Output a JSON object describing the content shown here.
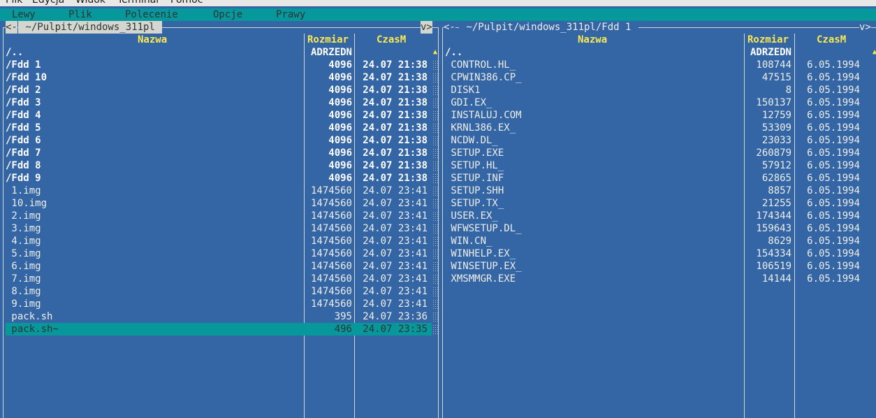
{
  "terminal_menu": [
    "Plik",
    "Edycja",
    "Widok",
    "Terminal",
    "Pomoc"
  ],
  "mc_menu": [
    "Lewy",
    "Plik",
    "Polecenie",
    "Opcje",
    "Prawy"
  ],
  "left_panel": {
    "corner_left": "<-",
    "path": " ~/Pulpit/windows_311pl ",
    "corner_right": "v>",
    "headers": {
      "name": "Nazwa",
      "size": "Rozmiar",
      "mtime": "CzasM"
    },
    "rows": [
      {
        "name": "/..",
        "size": "ADRZEDN",
        "time": "",
        "style": "updir"
      },
      {
        "name": "/Fdd 1",
        "size": "4096",
        "time": "24.07 21:38",
        "style": "dir"
      },
      {
        "name": "/Fdd 10",
        "size": "4096",
        "time": "24.07 21:38",
        "style": "dir"
      },
      {
        "name": "/Fdd 2",
        "size": "4096",
        "time": "24.07 21:38",
        "style": "dir"
      },
      {
        "name": "/Fdd 3",
        "size": "4096",
        "time": "24.07 21:38",
        "style": "dir"
      },
      {
        "name": "/Fdd 4",
        "size": "4096",
        "time": "24.07 21:38",
        "style": "dir"
      },
      {
        "name": "/Fdd 5",
        "size": "4096",
        "time": "24.07 21:38",
        "style": "dir"
      },
      {
        "name": "/Fdd 6",
        "size": "4096",
        "time": "24.07 21:38",
        "style": "dir"
      },
      {
        "name": "/Fdd 7",
        "size": "4096",
        "time": "24.07 21:38",
        "style": "dir"
      },
      {
        "name": "/Fdd 8",
        "size": "4096",
        "time": "24.07 21:38",
        "style": "dir"
      },
      {
        "name": "/Fdd 9",
        "size": "4096",
        "time": "24.07 21:38",
        "style": "dir"
      },
      {
        "name": " 1.img",
        "size": "1474560",
        "time": "24.07 23:41",
        "style": "file"
      },
      {
        "name": " 10.img",
        "size": "1474560",
        "time": "24.07 23:41",
        "style": "file"
      },
      {
        "name": " 2.img",
        "size": "1474560",
        "time": "24.07 23:41",
        "style": "file"
      },
      {
        "name": " 3.img",
        "size": "1474560",
        "time": "24.07 23:41",
        "style": "file"
      },
      {
        "name": " 4.img",
        "size": "1474560",
        "time": "24.07 23:41",
        "style": "file"
      },
      {
        "name": " 5.img",
        "size": "1474560",
        "time": "24.07 23:41",
        "style": "file"
      },
      {
        "name": " 6.img",
        "size": "1474560",
        "time": "24.07 23:41",
        "style": "file"
      },
      {
        "name": " 7.img",
        "size": "1474560",
        "time": "24.07 23:41",
        "style": "file"
      },
      {
        "name": " 8.img",
        "size": "1474560",
        "time": "24.07 23:41",
        "style": "file"
      },
      {
        "name": " 9.img",
        "size": "1474560",
        "time": "24.07 23:41",
        "style": "file"
      },
      {
        "name": " pack.sh",
        "size": "395",
        "time": "24.07 23:36",
        "style": "file"
      },
      {
        "name": " pack.sh~",
        "size": "496",
        "time": "24.07 23:35",
        "style": "selected"
      }
    ],
    "scroll_arrow": "▲"
  },
  "right_panel": {
    "corner_left": "<-",
    "path": " ~/Pulpit/windows_311pl/Fdd 1 ",
    "corner_right": "v>",
    "headers": {
      "name": "Nazwa",
      "size": "Rozmiar",
      "mtime": "CzasM"
    },
    "rows": [
      {
        "name": "/..",
        "size": "ADRZEDN",
        "time": "",
        "style": "updir"
      },
      {
        "name": " CONTROL.HL_",
        "size": "108744",
        "time": "6.05.1994",
        "style": "file"
      },
      {
        "name": " CPWIN386.CP_",
        "size": "47515",
        "time": "6.05.1994",
        "style": "file"
      },
      {
        "name": " DISK1",
        "size": "8",
        "time": "6.05.1994",
        "style": "file"
      },
      {
        "name": " GDI.EX_",
        "size": "150137",
        "time": "6.05.1994",
        "style": "file"
      },
      {
        "name": " INSTALUJ.COM",
        "size": "12759",
        "time": "6.05.1994",
        "style": "file"
      },
      {
        "name": " KRNL386.EX_",
        "size": "53309",
        "time": "6.05.1994",
        "style": "file"
      },
      {
        "name": " NCDW.DL_",
        "size": "23033",
        "time": "6.05.1994",
        "style": "file"
      },
      {
        "name": " SETUP.EXE",
        "size": "260879",
        "time": "6.05.1994",
        "style": "file"
      },
      {
        "name": " SETUP.HL_",
        "size": "57912",
        "time": "6.05.1994",
        "style": "file"
      },
      {
        "name": " SETUP.INF",
        "size": "62865",
        "time": "6.05.1994",
        "style": "file"
      },
      {
        "name": " SETUP.SHH",
        "size": "8857",
        "time": "6.05.1994",
        "style": "file"
      },
      {
        "name": " SETUP.TX_",
        "size": "21255",
        "time": "6.05.1994",
        "style": "file"
      },
      {
        "name": " USER.EX_",
        "size": "174344",
        "time": "6.05.1994",
        "style": "file"
      },
      {
        "name": " WFWSETUP.DL_",
        "size": "159643",
        "time": "6.05.1994",
        "style": "file"
      },
      {
        "name": " WIN.CN_",
        "size": "8629",
        "time": "6.05.1994",
        "style": "file"
      },
      {
        "name": " WINHELP.EX_",
        "size": "154334",
        "time": "6.05.1994",
        "style": "file"
      },
      {
        "name": " WINSETUP.EX_",
        "size": "106519",
        "time": "6.05.1994",
        "style": "file"
      },
      {
        "name": " XMSMMGR.EXE",
        "size": "14144",
        "time": "6.05.1994",
        "style": "file"
      }
    ],
    "scroll_arrow": "▲"
  },
  "colors": {
    "panel_bg": "#3465a4",
    "menubar_bg": "#06989a",
    "header_yellow": "#fce94f",
    "border": "#d3d7cf"
  },
  "icons": {
    "scrollbar": "dotted-scroll-track"
  }
}
